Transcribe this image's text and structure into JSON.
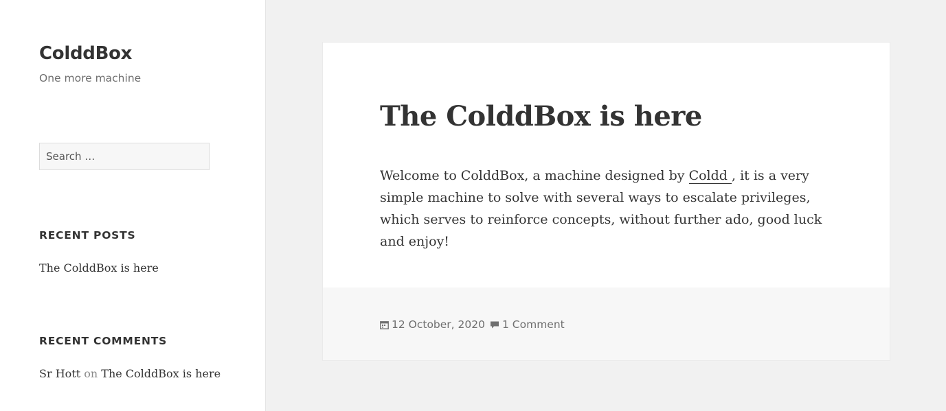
{
  "site": {
    "title": "ColddBox",
    "description": "One more machine"
  },
  "search": {
    "placeholder": "Search …"
  },
  "widgets": {
    "recent_posts": {
      "title": "RECENT POSTS",
      "items": [
        "The ColddBox is here"
      ]
    },
    "recent_comments": {
      "title": "RECENT COMMENTS",
      "items": [
        {
          "author": "Sr Hott",
          "connector": "on",
          "post": "The ColddBox is here"
        }
      ]
    }
  },
  "post": {
    "title": "The ColddBox is here",
    "content": {
      "before_link": "Welcome to ColddBox, a machine designed by ",
      "link_text": "Coldd ",
      "after_link": ", it is a very simple machine to solve with several ways to escalate privileges, which serves to reinforce concepts, without further ado, good luck and enjoy!"
    },
    "meta": {
      "date": "12 October, 2020",
      "date_icon": "calendar-icon",
      "comments": "1 Comment",
      "comments_icon": "comment-bubble-icon"
    }
  },
  "colors": {
    "background": "#f1f1f1",
    "panel": "#ffffff",
    "text": "#333333",
    "muted": "#707070",
    "footer": "#f7f7f7"
  }
}
